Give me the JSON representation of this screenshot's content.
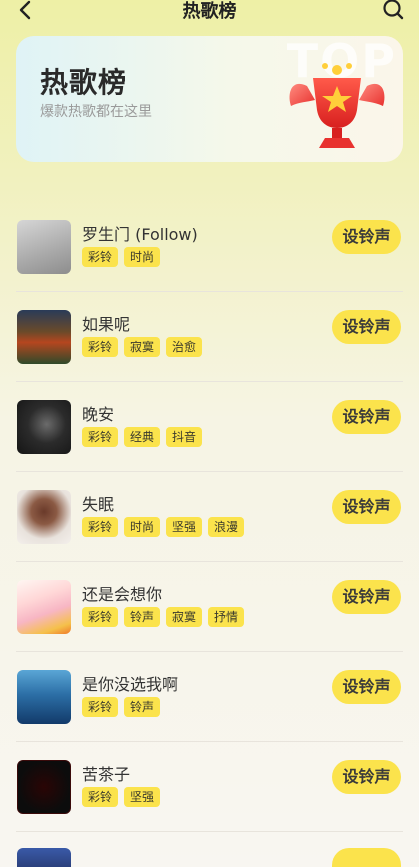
{
  "header": {
    "title": "热歌榜"
  },
  "banner": {
    "title": "热歌榜",
    "subtitle": "爆款热歌都在这里",
    "bg_text": "TOP"
  },
  "songs": [
    {
      "title": "罗生门 (Follow)",
      "tags": [
        "彩铃",
        "时尚"
      ],
      "action": "设铃声"
    },
    {
      "title": "如果呢",
      "tags": [
        "彩铃",
        "寂寞",
        "治愈"
      ],
      "action": "设铃声"
    },
    {
      "title": "晚安",
      "tags": [
        "彩铃",
        "经典",
        "抖音"
      ],
      "action": "设铃声"
    },
    {
      "title": "失眠",
      "tags": [
        "彩铃",
        "时尚",
        "坚强",
        "浪漫"
      ],
      "action": "设铃声"
    },
    {
      "title": "还是会想你",
      "tags": [
        "彩铃",
        "铃声",
        "寂寞",
        "抒情"
      ],
      "action": "设铃声"
    },
    {
      "title": "是你没选我啊",
      "tags": [
        "彩铃",
        "铃声"
      ],
      "action": "设铃声"
    },
    {
      "title": "苦茶子",
      "tags": [
        "彩铃",
        "坚强"
      ],
      "action": "设铃声"
    }
  ],
  "colors": {
    "accent": "#fbe34c",
    "trophy": "#e8322f"
  }
}
